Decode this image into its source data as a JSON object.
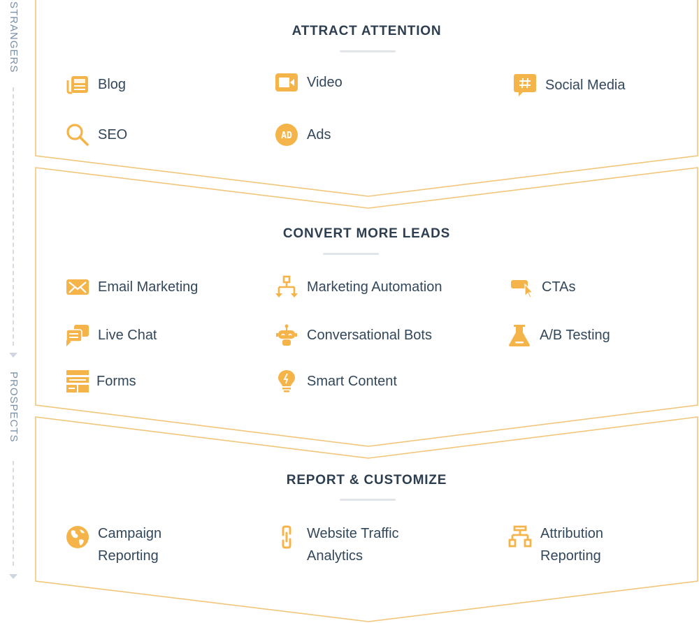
{
  "side_labels": {
    "top": "STRANGERS",
    "middle": "PROSPECTS"
  },
  "colors": {
    "accent": "#f5b44a",
    "frame": "#f2c67a",
    "heading": "#2d3e50",
    "text": "#33475b",
    "side": "#7c8fa8"
  },
  "sections": [
    {
      "title": "ATTRACT ATTENTION",
      "items": [
        {
          "label": "Blog",
          "icon": "newspaper-icon"
        },
        {
          "label": "Video",
          "icon": "video-camera-icon"
        },
        {
          "label": "Social Media",
          "icon": "hashtag-chat-icon"
        },
        {
          "label": "SEO",
          "icon": "magnifier-icon"
        },
        {
          "label": "Ads",
          "icon": "ad-badge-icon"
        }
      ]
    },
    {
      "title": "CONVERT MORE LEADS",
      "items": [
        {
          "label": "Email Marketing",
          "icon": "envelope-icon"
        },
        {
          "label": "Marketing Automation",
          "icon": "workflow-icon"
        },
        {
          "label": "CTAs",
          "icon": "cta-cursor-icon"
        },
        {
          "label": "Live Chat",
          "icon": "chat-bubbles-icon"
        },
        {
          "label": "Conversational Bots",
          "icon": "robot-icon"
        },
        {
          "label": "A/B Testing",
          "icon": "flask-icon"
        },
        {
          "label": "Forms",
          "icon": "form-icon"
        },
        {
          "label": "Smart Content",
          "icon": "lightbulb-icon"
        }
      ]
    },
    {
      "title": "REPORT & CUSTOMIZE",
      "items": [
        {
          "label": "Campaign",
          "label2": "Reporting",
          "icon": "globe-icon"
        },
        {
          "label": "Website Traffic",
          "label2": "Analytics",
          "icon": "link-icon"
        },
        {
          "label": "Attribution",
          "label2": "Reporting",
          "icon": "hierarchy-icon"
        }
      ]
    }
  ]
}
